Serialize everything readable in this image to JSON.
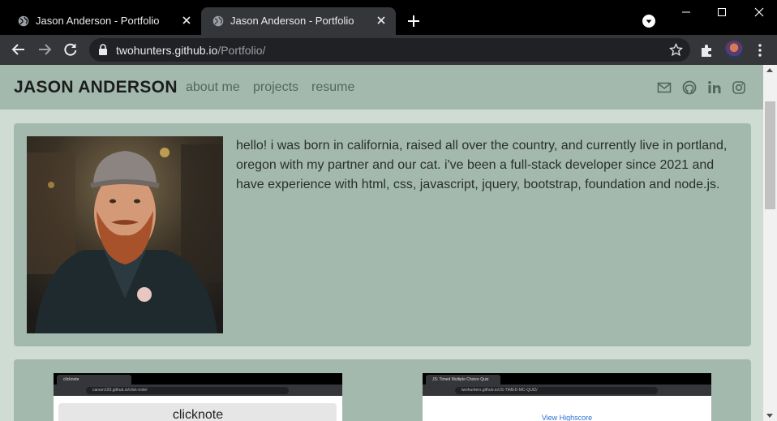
{
  "browser": {
    "tabs": [
      {
        "title": "Jason Anderson - Portfolio",
        "active": false
      },
      {
        "title": "Jason Anderson - Portfolio",
        "active": true
      }
    ],
    "url_host": "twohunters.github.io",
    "url_path": "/Portfolio/"
  },
  "header": {
    "brand": "JASON ANDERSON",
    "nav": [
      {
        "label": "about me"
      },
      {
        "label": "projects"
      },
      {
        "label": "resume"
      }
    ],
    "social_icons": [
      "mail-icon",
      "github-icon",
      "linkedin-icon",
      "instagram-icon"
    ]
  },
  "about": {
    "bio": "hello! i was born in california, raised all over the country, and currently live in portland, oregon with my partner and our cat. i've been a full-stack developer since 2021 and have experience with html, css, javascript, jquery, bootstrap, foundation and node.js."
  },
  "projects": [
    {
      "tab": "clicknote",
      "url": "carson193.github.io/click-note/",
      "heading": "clicknote"
    },
    {
      "tab": "JS: Timed Multiple Choice Quiz",
      "url": "twohunters.github.io/JS-TIMED-MC-QUIZ/",
      "heading": "View Highscore"
    }
  ],
  "colors": {
    "page_background": "#cfdcd4",
    "card_background": "#a3b9ae",
    "nav_link": "#55655d",
    "brand_text": "#1c1c1c"
  }
}
